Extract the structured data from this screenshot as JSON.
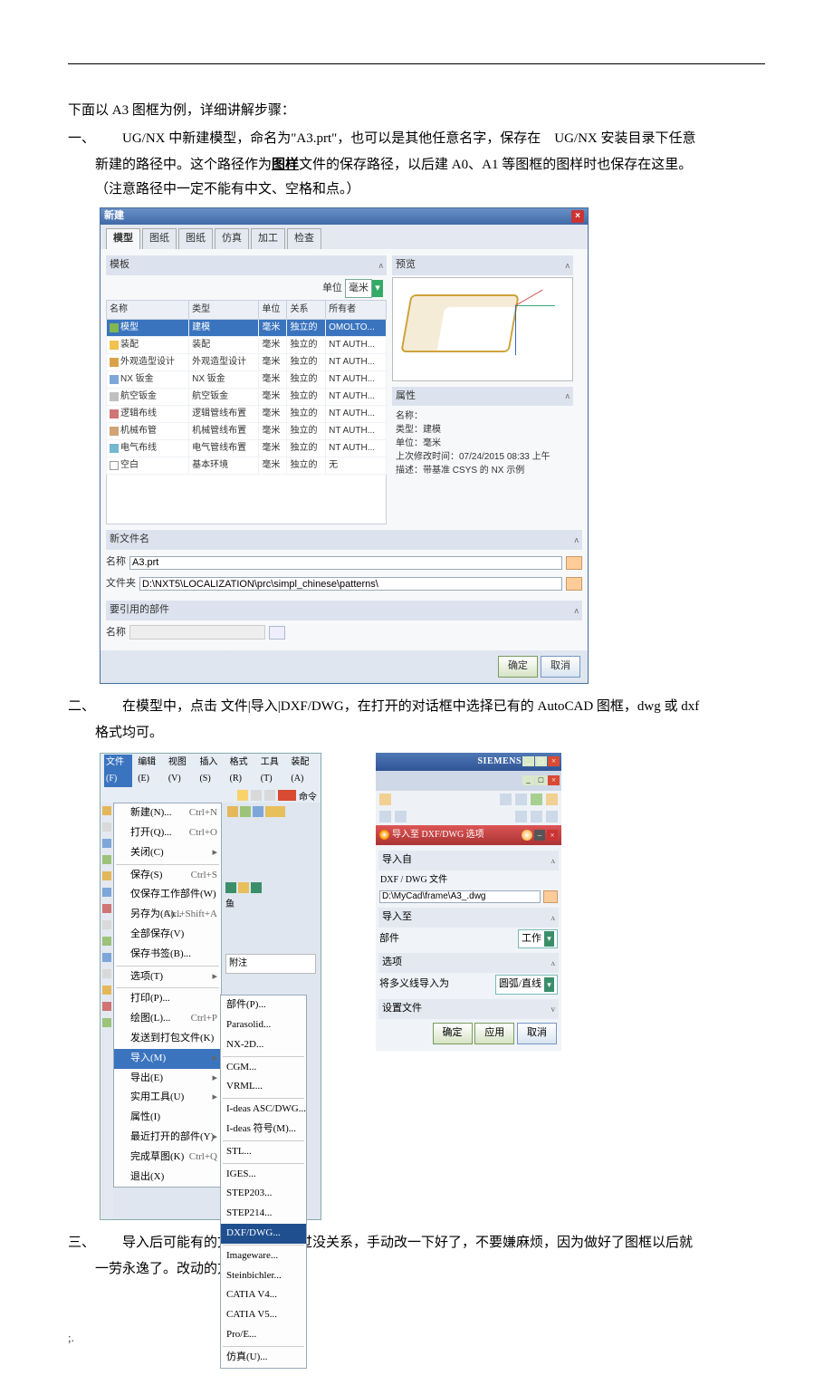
{
  "intro": "下面以 A3 图框为例，详细讲解步骤：",
  "step1_num": "一、",
  "step1_line1": "UG/NX 中新建模型，命名为\"A3.prt\"，也可以是其他任意名字，保存在 UG/NX 安装目录下任意",
  "step1_line2a": "新建的路径中。这个路径作为",
  "step1_line2u": "图样",
  "step1_line2b": "文件的保存路径，以后建 A0、A1 等图框的图样时也保存在这里。",
  "step1_note": "（注意路径中一定不能有中文、空格和点。）",
  "dlg1": {
    "title": "新建",
    "tabs": [
      "模型",
      "图纸",
      "图纸",
      "仿真",
      "加工",
      "检查"
    ],
    "left_head": "模板",
    "preview_head": "预览",
    "unit_label": "单位",
    "unit_value": "毫米",
    "cols": [
      "名称",
      "类型",
      "单位",
      "关系",
      "所有者"
    ],
    "rows": [
      {
        "name": "模型",
        "type": "建模",
        "unit": "毫米",
        "rel": "独立的",
        "own": "OMOLTO...",
        "ico": "i-mod",
        "sel": true
      },
      {
        "name": "装配",
        "type": "装配",
        "unit": "毫米",
        "rel": "独立的",
        "own": "NT AUTH...",
        "ico": "i-asm"
      },
      {
        "name": "外观造型设计",
        "type": "外观造型设计",
        "unit": "毫米",
        "rel": "独立的",
        "own": "NT AUTH...",
        "ico": "i-des"
      },
      {
        "name": "NX 钣金",
        "type": "NX 钣金",
        "unit": "毫米",
        "rel": "独立的",
        "own": "NT AUTH...",
        "ico": "i-sheet"
      },
      {
        "name": "航空钣金",
        "type": "航空钣金",
        "unit": "毫米",
        "rel": "独立的",
        "own": "NT AUTH...",
        "ico": "i-air"
      },
      {
        "name": "逻辑布线",
        "type": "逻辑管线布置",
        "unit": "毫米",
        "rel": "独立的",
        "own": "NT AUTH...",
        "ico": "i-rt1"
      },
      {
        "name": "机械布管",
        "type": "机械管线布置",
        "unit": "毫米",
        "rel": "独立的",
        "own": "NT AUTH...",
        "ico": "i-rt2"
      },
      {
        "name": "电气布线",
        "type": "电气管线布置",
        "unit": "毫米",
        "rel": "独立的",
        "own": "NT AUTH...",
        "ico": "i-rt3"
      },
      {
        "name": "空白",
        "type": "基本环境",
        "unit": "毫米",
        "rel": "独立的",
        "own": "无",
        "ico": "i-blank"
      }
    ],
    "prop_head": "属性",
    "prop_lines": [
      "名称：",
      "类型：建模",
      "单位：毫米",
      "上次修改时间：07/24/2015 08:33 上午",
      "描述：带基准 CSYS 的 NX 示例"
    ],
    "newfile_head": "新文件名",
    "name_lbl": "名称",
    "name_val": "A3.prt",
    "folder_lbl": "文件夹",
    "folder_val": "D:\\NXT5\\LOCALIZATION\\prc\\simpl_chinese\\patterns\\",
    "ref_head": "要引用的部件",
    "ref_lbl": "名称",
    "ok": "确定",
    "cancel": "取消"
  },
  "step2_num": "二、",
  "step2_line1": "在模型中，点击 文件|导入|DXF/DWG，在打开的对话框中选择已有的 AutoCAD 图框，dwg 或 dxf",
  "step2_line2": "格式均可。",
  "menu": {
    "bar": [
      "文件(F)",
      "编辑(E)",
      "视图(V)",
      "插入(S)",
      "格式(R)",
      "工具(T)",
      "装配(A)"
    ],
    "rtool": "命令",
    "items1": [
      {
        "t": "新建(N)...",
        "sc": "Ctrl+N"
      },
      {
        "t": "打开(Q)...",
        "sc": "Ctrl+O"
      },
      {
        "t": "关闭(C)",
        "sc": "▸"
      }
    ],
    "items2": [
      {
        "t": "保存(S)",
        "sc": "Ctrl+S"
      },
      {
        "t": "仅保存工作部件(W)",
        "sc": ""
      },
      {
        "t": "另存为(A)...",
        "sc": "Ctrl+Shift+A"
      },
      {
        "t": "全部保存(V)",
        "sc": ""
      },
      {
        "t": "保存书签(B)...",
        "sc": ""
      }
    ],
    "items3": [
      {
        "t": "选项(T)",
        "sc": "▸"
      }
    ],
    "items4": [
      {
        "t": "打印(P)...",
        "sc": ""
      },
      {
        "t": "绘图(L)...",
        "sc": "Ctrl+P"
      },
      {
        "t": "发送到打包文件(K)",
        "sc": ""
      },
      {
        "t": "导入(M)",
        "sc": "▸",
        "sel": true
      },
      {
        "t": "导出(E)",
        "sc": "▸"
      },
      {
        "t": "实用工具(U)",
        "sc": "▸"
      },
      {
        "t": "属性(I)",
        "sc": ""
      },
      {
        "t": "最近打开的部件(Y)",
        "sc": "▸"
      },
      {
        "t": "完成草图(K)",
        "sc": "Ctrl+Q"
      },
      {
        "t": "退出(X)",
        "sc": ""
      }
    ],
    "sub": [
      "部件(P)...",
      "Parasolid...",
      "NX-2D...",
      "CGM...",
      "VRML...",
      "I-deas ASC/DWG...",
      "I-deas 符号(M)...",
      "STL...",
      "IGES...",
      "STEP203...",
      "STEP214...",
      "DXF/DWG...",
      "Imageware...",
      "Steinbichler...",
      "CATIA V4...",
      "CATIA V5...",
      "Pro/E...",
      "仿真(U)..."
    ],
    "sub_sel": "DXF/DWG...",
    "annot": "附注",
    "fish": "鱼"
  },
  "dlg2": {
    "brand": "SIEMENS",
    "panel_title": "导入至 DXF/DWG 选项",
    "s_from": "导入自",
    "from_lbl": "DXF / DWG 文件",
    "from_val": "D:\\MyCad\\frame\\A3_.dwg",
    "s_to": "导入至",
    "to_lbl": "部件",
    "to_val": "工作",
    "s_opt": "选项",
    "opt_lbl": "将多义线导入为",
    "opt_val": "圆弧/直线",
    "set_lbl": "设置文件",
    "ok": "确定",
    "apply": "应用",
    "cancel": "取消"
  },
  "step3_num": "三、",
  "step3_line1": "导入后可能有的文字乱码，不过没关系，手动改一下好了，不要嫌麻烦，因为做好了图框以后就",
  "step3_line2": "一劳永逸了。改动的方法是：",
  "footer": ";."
}
